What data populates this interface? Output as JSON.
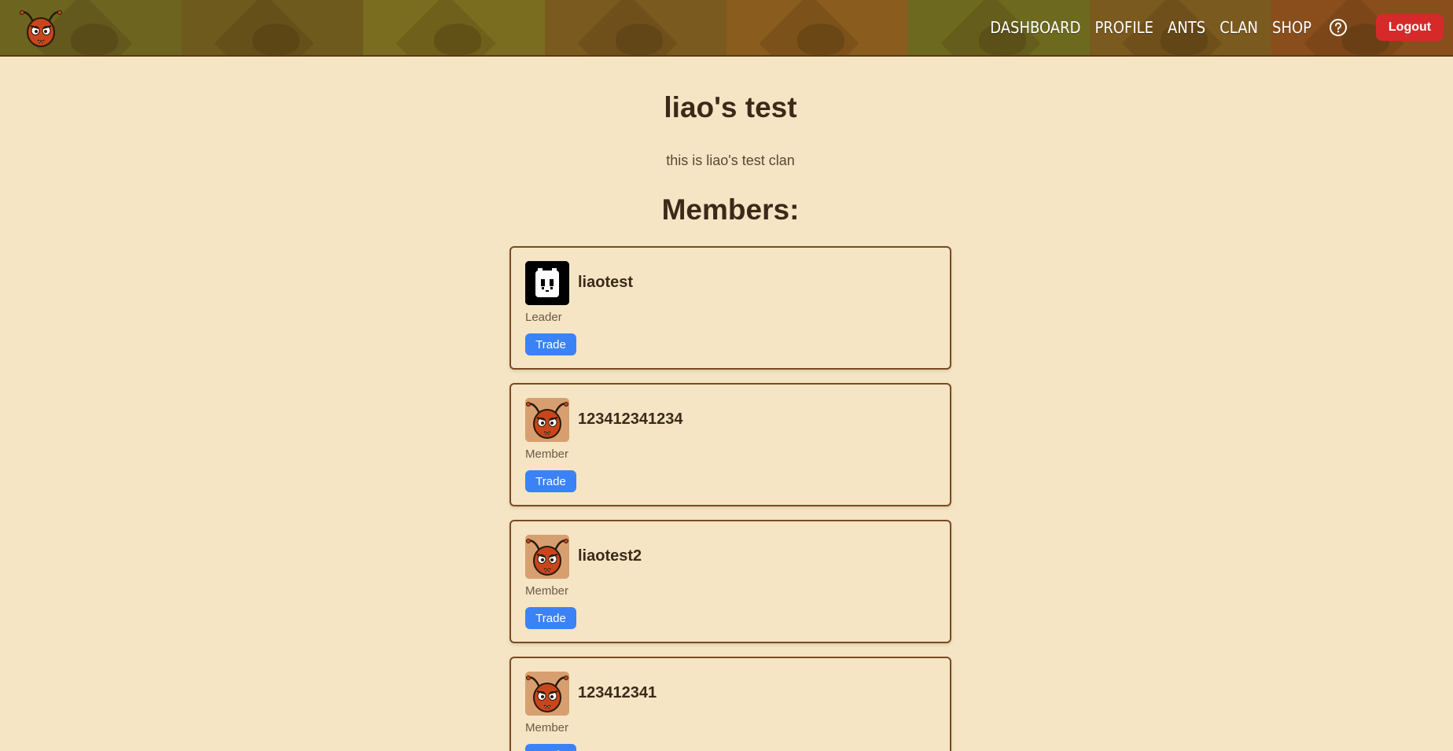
{
  "nav": {
    "links": [
      "DASHBOARD",
      "PROFILE",
      "ANTS",
      "CLAN",
      "SHOP"
    ],
    "logout_label": "Logout",
    "logo_icon": "ant-logo-icon",
    "help_icon": "question-circle-icon"
  },
  "clan": {
    "name": "liao's test",
    "description": "this is liao's test clan",
    "members_heading": "Members:"
  },
  "members": [
    {
      "name": "liaotest",
      "role": "Leader",
      "trade_label": "Trade",
      "avatar": "robot-avatar"
    },
    {
      "name": "123412341234",
      "role": "Member",
      "trade_label": "Trade",
      "avatar": "ant-avatar"
    },
    {
      "name": "liaotest2",
      "role": "Member",
      "trade_label": "Trade",
      "avatar": "ant-avatar"
    },
    {
      "name": "123412341",
      "role": "Member",
      "trade_label": "Trade",
      "avatar": "ant-avatar"
    }
  ],
  "colors": {
    "background": "#f5e5c4",
    "trade_button": "#3b82f6",
    "logout_button": "#d62a2a",
    "card_border": "#7a4a22"
  }
}
